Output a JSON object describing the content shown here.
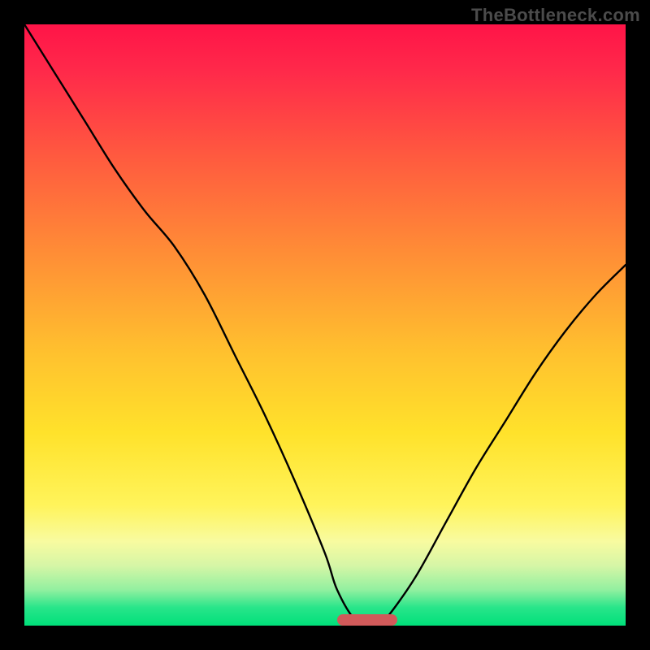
{
  "watermark": "TheBottleneck.com",
  "chart_data": {
    "type": "line",
    "title": "",
    "xlabel": "",
    "ylabel": "",
    "xlim": [
      0,
      100
    ],
    "ylim": [
      0,
      100
    ],
    "x": [
      0,
      5,
      10,
      15,
      20,
      25,
      30,
      35,
      40,
      45,
      50,
      52,
      55,
      58,
      60,
      65,
      70,
      75,
      80,
      85,
      90,
      95,
      100
    ],
    "values": [
      100,
      92,
      84,
      76,
      69,
      63,
      55,
      45,
      35,
      24,
      12,
      6,
      1,
      0,
      1,
      8,
      17,
      26,
      34,
      42,
      49,
      55,
      60
    ],
    "minimum_x": 58,
    "marker": {
      "x_start": 52,
      "x_end": 62,
      "y": 0
    },
    "colors": {
      "curve": "#000000",
      "marker": "#d15a5a",
      "gradient_top": "#ff1448",
      "gradient_bottom": "#00e07a"
    }
  }
}
